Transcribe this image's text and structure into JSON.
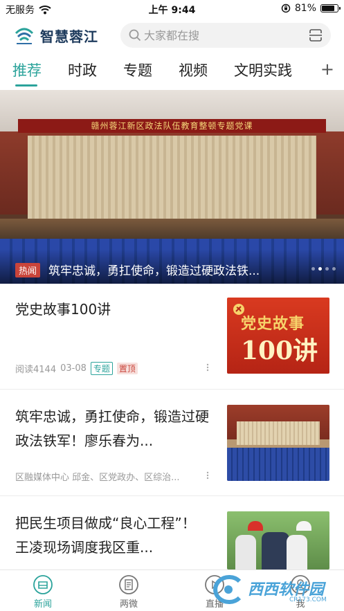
{
  "status_bar": {
    "carrier": "无服务",
    "time": "上午 9:44",
    "battery": "81%",
    "battery_level": 0.81
  },
  "header": {
    "app_name": "智慧蓉江",
    "search_placeholder": "大家都在搜"
  },
  "tabs": [
    {
      "label": "推荐",
      "active": true
    },
    {
      "label": "时政",
      "active": false
    },
    {
      "label": "专题",
      "active": false
    },
    {
      "label": "视频",
      "active": false
    },
    {
      "label": "文明实践",
      "active": false
    }
  ],
  "banner": {
    "stage_text": "赣州蓉江新区政法队伍教育整顿专题党课",
    "tag": "热闻",
    "caption": "筑牢忠诚，勇扛使命，锻造过硬政法铁..."
  },
  "news": [
    {
      "title": "党史故事100讲",
      "meta_reads": "阅读4144",
      "meta_date": "03-08",
      "badge_topic": "专题",
      "badge_top": "置顶",
      "thumb_text": "党史故事",
      "thumb_num": "100讲"
    },
    {
      "title": "筑牢忠诚，勇扛使命，锻造过硬政法铁军！廖乐春为...",
      "meta_source": "区融媒体中心 邱金、区党政办、区综治..."
    },
    {
      "title": "把民生项目做成“良心工程”！王凌现场调度我区重..."
    }
  ],
  "bottom_nav": [
    {
      "label": "新闻",
      "active": true
    },
    {
      "label": "两微",
      "active": false
    },
    {
      "label": "直播",
      "active": false
    },
    {
      "label": "我",
      "active": false
    }
  ],
  "watermark": {
    "text": "西西软件园",
    "sub": "CR173.COM"
  },
  "colors": {
    "accent": "#2ba39b",
    "hot": "#c9443a"
  }
}
